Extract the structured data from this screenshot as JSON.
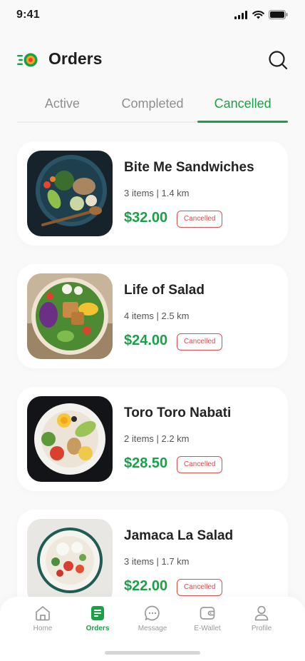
{
  "status_bar": {
    "time": "9:41"
  },
  "header": {
    "title": "Orders",
    "logo_icon": "food-delivery-logo",
    "search_icon": "search-icon"
  },
  "tabs": [
    {
      "label": "Active",
      "active": false
    },
    {
      "label": "Completed",
      "active": false
    },
    {
      "label": "Cancelled",
      "active": true
    }
  ],
  "orders": [
    {
      "name": "Bite Me Sandwiches",
      "meta": "3 items  |  1.4 km",
      "price": "$32.00",
      "status": "Cancelled"
    },
    {
      "name": "Life of Salad",
      "meta": "4 items  |  2.5 km",
      "price": "$24.00",
      "status": "Cancelled"
    },
    {
      "name": "Toro Toro Nabati",
      "meta": "2 items  |  2.2 km",
      "price": "$28.50",
      "status": "Cancelled"
    },
    {
      "name": "Jamaca La Salad",
      "meta": "3 items  |  1.7 km",
      "price": "$22.00",
      "status": "Cancelled"
    }
  ],
  "bottom_nav": [
    {
      "label": "Home",
      "icon": "home-icon",
      "active": false
    },
    {
      "label": "Orders",
      "icon": "orders-icon",
      "active": true
    },
    {
      "label": "Message",
      "icon": "message-icon",
      "active": false
    },
    {
      "label": "E-Wallet",
      "icon": "wallet-icon",
      "active": false
    },
    {
      "label": "Profile",
      "icon": "profile-icon",
      "active": false
    }
  ],
  "colors": {
    "accent": "#1aa148",
    "cancelled": "#e64a4a",
    "background": "#f9f9f9",
    "card": "#ffffff"
  }
}
